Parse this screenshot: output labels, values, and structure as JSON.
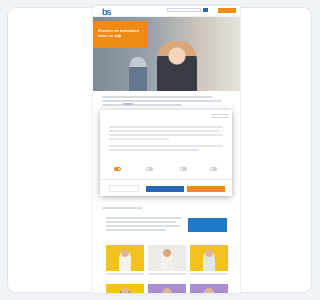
{
  "window": {
    "logo": "bs",
    "cta_label": "",
    "nav": [
      "",
      "",
      "",
      "",
      ""
    ]
  },
  "hero": {
    "title": "Ervaren en betrokken\nleren en kijk"
  },
  "content": {
    "sublink": "",
    "section_label": ""
  },
  "cookie_modal": {
    "title": "",
    "language": "",
    "options": [
      "",
      "",
      "",
      ""
    ],
    "details_link": "",
    "powered_by": "",
    "button_left": "",
    "button_right": ""
  },
  "team": {
    "title": "",
    "subtitle": "",
    "box_text": ""
  },
  "colors": {
    "brand_orange": "#ef8a16",
    "brand_blue": "#2a66b8",
    "tile_yellow": "#f2c21d",
    "tile_light": "#eeeae6",
    "tile_purple": "#a98fcf"
  },
  "icons": [
    "logo-icon",
    "search-icon",
    "toggle-icon"
  ]
}
